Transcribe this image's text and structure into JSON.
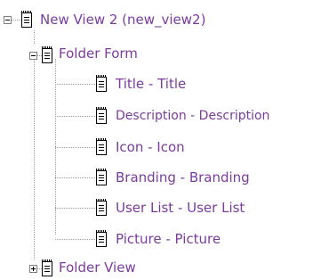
{
  "tree": {
    "root": {
      "label": "New View 2 (new_view2)",
      "expanded": true,
      "icon": "document-icon"
    },
    "children": [
      {
        "label": "Folder Form",
        "expanded": true,
        "icon": "document-icon",
        "children": [
          {
            "label": "Title - Title",
            "icon": "document-icon"
          },
          {
            "label": "Description - Description",
            "icon": "document-icon"
          },
          {
            "label": "Icon - Icon",
            "icon": "document-icon"
          },
          {
            "label": "Branding - Branding",
            "icon": "document-icon"
          },
          {
            "label": "User List - User List",
            "icon": "document-icon"
          },
          {
            "label": "Picture - Picture",
            "icon": "document-icon"
          }
        ]
      },
      {
        "label": "Folder View",
        "expanded": false,
        "icon": "document-icon"
      }
    ]
  },
  "colors": {
    "label": "#7b3c9c",
    "connector": "#9a9a9a",
    "background": "#ffffff"
  }
}
